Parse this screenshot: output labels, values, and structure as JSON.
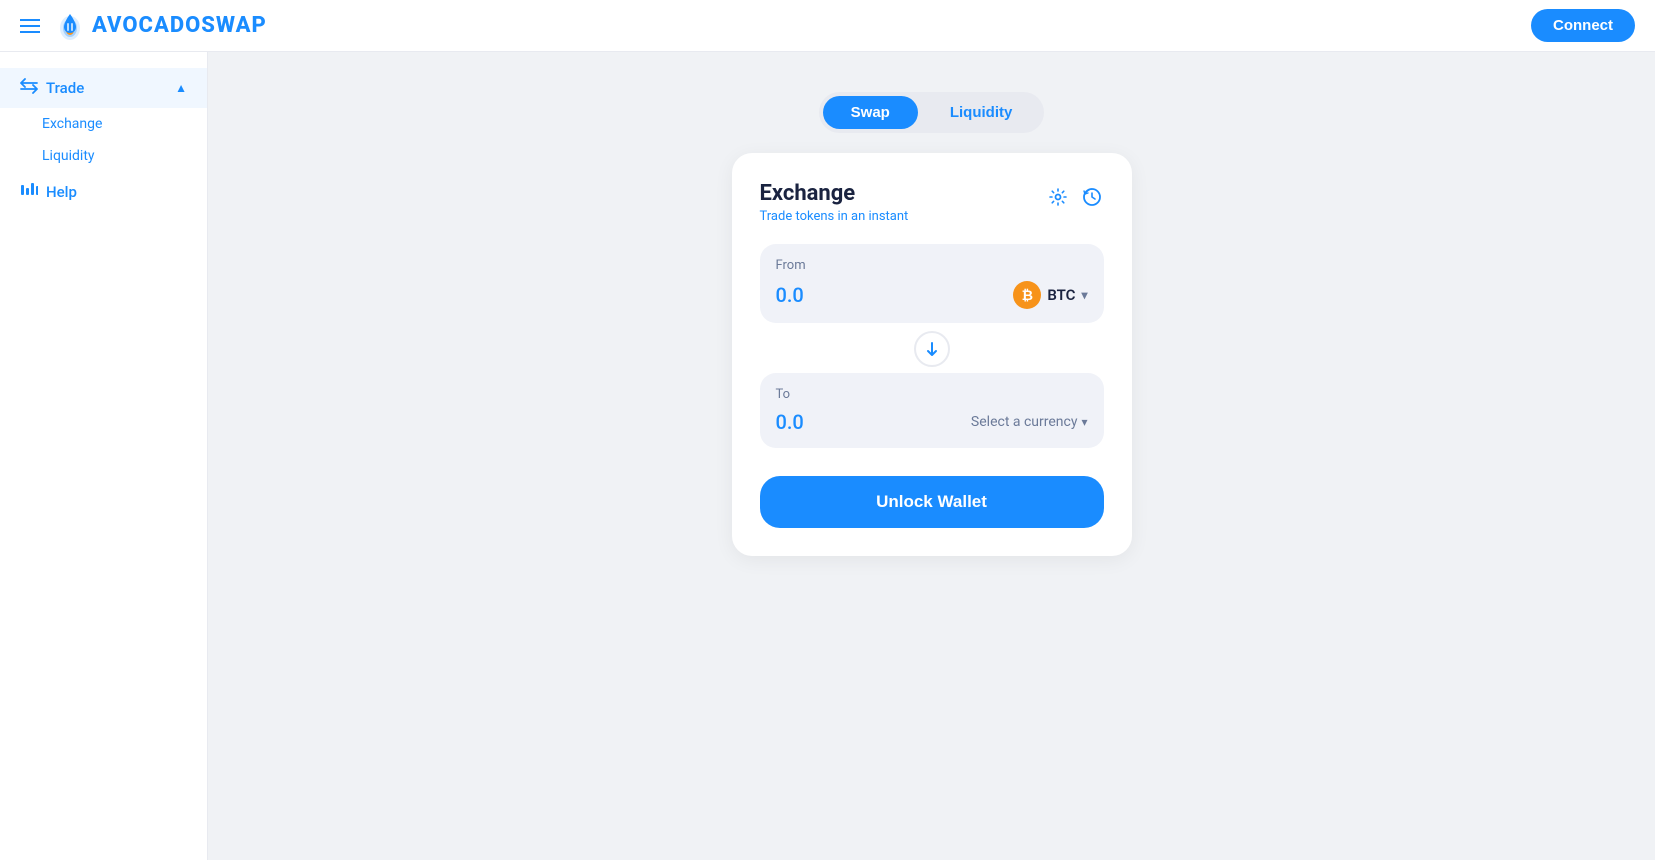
{
  "header": {
    "menu_label": "menu",
    "logo_text": "AVOCADOSWAP",
    "connect_label": "Connect"
  },
  "sidebar": {
    "trade_label": "Trade",
    "trade_arrow": "▲",
    "sub_items": [
      {
        "id": "exchange",
        "label": "Exchange"
      },
      {
        "id": "liquidity",
        "label": "Liquidity"
      }
    ],
    "help_label": "Help"
  },
  "tabs": [
    {
      "id": "swap",
      "label": "Swap",
      "active": true
    },
    {
      "id": "liquidity",
      "label": "Liquidity",
      "active": false
    }
  ],
  "exchange_card": {
    "title": "Exchange",
    "subtitle": "Trade tokens in an instant",
    "settings_icon": "⚙",
    "history_icon": "⏱",
    "from": {
      "label": "From",
      "amount": "0.0",
      "token": "BTC",
      "token_symbol": "₿"
    },
    "swap_arrow": "↓",
    "to": {
      "label": "To",
      "amount": "0.0",
      "currency_label": "Select a currency"
    },
    "unlock_btn_label": "Unlock Wallet"
  }
}
